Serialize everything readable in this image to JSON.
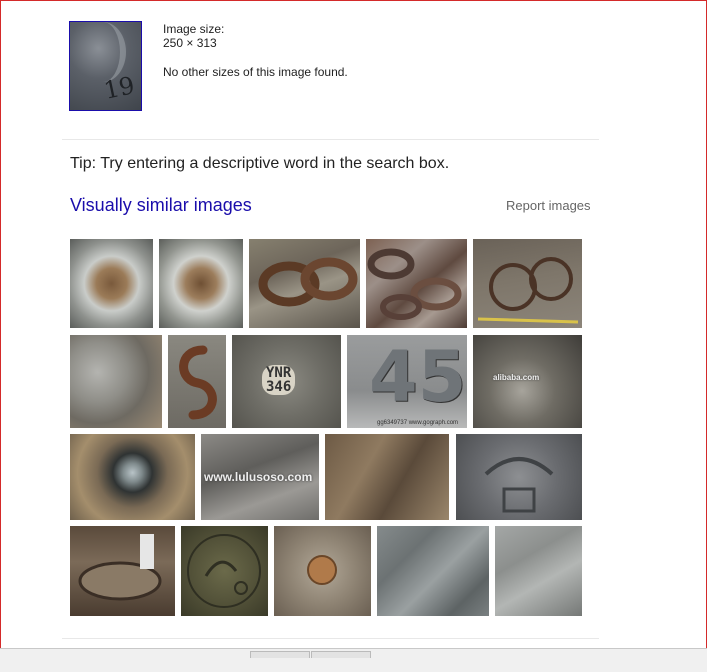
{
  "query_image": {
    "digits": "19",
    "alt": "query image thumbnail"
  },
  "info": {
    "size_label": "Image size:",
    "size_value": "250 × 313",
    "other_sizes": "No other sizes of this image found."
  },
  "tip": "Tip: Try entering a descriptive word in the search box.",
  "similar": {
    "title": "Visually similar images",
    "report": "Report images"
  },
  "thumb_text": {
    "t6": "YNR",
    "t6b": "346",
    "t7": "45",
    "t7cap": "gg6349737 www.gograph.com",
    "t8": "alibaba.com",
    "t10": "www.lulusoso.com"
  },
  "colors": {
    "link": "#1a0dab",
    "frame_border": "#d42a2a",
    "text": "#222222",
    "muted": "#666666"
  }
}
